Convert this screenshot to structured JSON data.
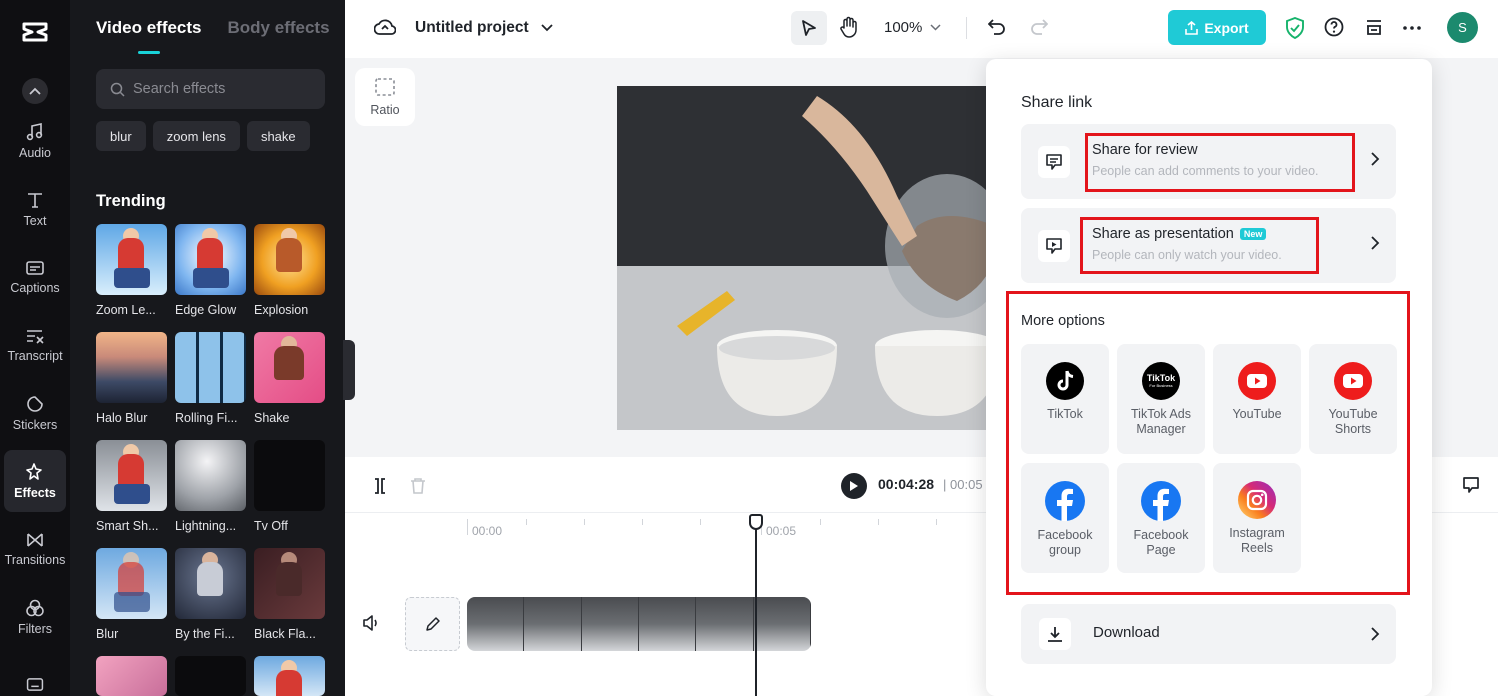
{
  "rail": {
    "items": [
      {
        "label": "Audio",
        "icon": "music-note-icon"
      },
      {
        "label": "Text",
        "icon": "text-icon"
      },
      {
        "label": "Captions",
        "icon": "captions-icon"
      },
      {
        "label": "Transcript",
        "icon": "transcript-icon"
      },
      {
        "label": "Stickers",
        "icon": "sticker-icon"
      },
      {
        "label": "Effects",
        "icon": "effects-icon",
        "active": true
      },
      {
        "label": "Transitions",
        "icon": "transitions-icon"
      },
      {
        "label": "Filters",
        "icon": "filters-icon"
      }
    ]
  },
  "panel": {
    "tab_video_effects": "Video effects",
    "tab_body_effects": "Body effects",
    "search_placeholder": "Search effects",
    "chips": [
      "blur",
      "zoom lens",
      "shake"
    ],
    "section_title": "Trending",
    "effects": [
      {
        "label": "Zoom Le..."
      },
      {
        "label": "Edge Glow"
      },
      {
        "label": "Explosion"
      },
      {
        "label": "Halo Blur"
      },
      {
        "label": "Rolling Fi..."
      },
      {
        "label": "Shake"
      },
      {
        "label": "Smart Sh..."
      },
      {
        "label": "Lightning..."
      },
      {
        "label": "Tv Off"
      },
      {
        "label": "Blur"
      },
      {
        "label": "By the Fi..."
      },
      {
        "label": "Black Fla..."
      }
    ]
  },
  "topbar": {
    "project_title": "Untitled project",
    "zoom": "100%",
    "export_label": "Export",
    "avatar_initial": "S"
  },
  "canvas": {
    "ratio_label": "Ratio"
  },
  "timeline": {
    "current_time": "00:04:28",
    "separator": "|",
    "total_time_partial": "00:05",
    "ruler": [
      "00:00",
      "00:05"
    ]
  },
  "share": {
    "title": "Share link",
    "review": {
      "name": "Share for review",
      "desc": "People can add comments to your video."
    },
    "presentation": {
      "name": "Share as presentation",
      "badge": "New",
      "desc": "People can only watch your video."
    },
    "more_title": "More options",
    "options": [
      {
        "label": "TikTok",
        "icon": "tiktok-icon"
      },
      {
        "label": "TikTok Ads Manager",
        "icon": "tiktok-business-icon"
      },
      {
        "label": "YouTube",
        "icon": "youtube-icon"
      },
      {
        "label": "YouTube Shorts",
        "icon": "youtube-icon"
      },
      {
        "label": "Facebook group",
        "icon": "facebook-icon"
      },
      {
        "label": "Facebook Page",
        "icon": "facebook-icon"
      },
      {
        "label": "Instagram Reels",
        "icon": "instagram-icon"
      }
    ],
    "tiktok_business_mark": "TikTok",
    "tiktok_business_sub": "For Business",
    "download_label": "Download"
  },
  "colors": {
    "accent": "#1fcad6",
    "highlight": "#e3141b",
    "youtube": "#ee1c1c",
    "facebook": "#1877f2"
  }
}
